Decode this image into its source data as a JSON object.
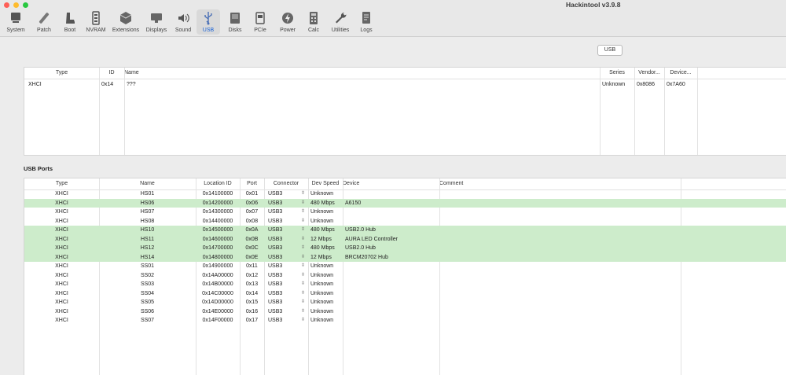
{
  "window": {
    "title": "Hackintool v3.9.8"
  },
  "toolbar": [
    {
      "label": "System",
      "icon": "system-icon"
    },
    {
      "label": "Patch",
      "icon": "patch-icon"
    },
    {
      "label": "Boot",
      "icon": "boot-icon"
    },
    {
      "label": "NVRAM",
      "icon": "nvram-icon"
    },
    {
      "label": "Extensions",
      "icon": "extensions-icon"
    },
    {
      "label": "Displays",
      "icon": "displays-icon"
    },
    {
      "label": "Sound",
      "icon": "sound-icon"
    },
    {
      "label": "USB",
      "icon": "usb-icon",
      "selected": true
    },
    {
      "label": "Disks",
      "icon": "disks-icon"
    },
    {
      "label": "PCIe",
      "icon": "pcie-icon"
    },
    {
      "label": "Power",
      "icon": "power-icon"
    },
    {
      "label": "Calc",
      "icon": "calc-icon"
    },
    {
      "label": "Utilities",
      "icon": "utilities-icon"
    },
    {
      "label": "Logs",
      "icon": "logs-icon"
    }
  ],
  "tab_label": "USB",
  "controllers": {
    "headers": [
      "Type",
      "ID",
      "Name",
      "Series",
      "Vendor...",
      "Device..."
    ],
    "rows": [
      {
        "type": "XHCI",
        "id": "0x14",
        "name": "???",
        "series": "Unknown",
        "vendor": "0x8086",
        "device": "0x7A60"
      }
    ]
  },
  "ports_label": "USB Ports",
  "ports": {
    "headers": [
      "Type",
      "Name",
      "Location ID",
      "Port",
      "Connector",
      "Dev Speed",
      "Device",
      "Comment"
    ],
    "rows": [
      {
        "type": "XHCI",
        "name": "HS01",
        "loc": "0x14100000",
        "port": "0x01",
        "conn": "USB3",
        "speed": "Unknown",
        "device": "",
        "hl": false
      },
      {
        "type": "XHCI",
        "name": "HS06",
        "loc": "0x14200000",
        "port": "0x06",
        "conn": "USB3",
        "speed": "480 Mbps",
        "device": "A6150",
        "hl": true
      },
      {
        "type": "XHCI",
        "name": "HS07",
        "loc": "0x14300000",
        "port": "0x07",
        "conn": "USB3",
        "speed": "Unknown",
        "device": "",
        "hl": false
      },
      {
        "type": "XHCI",
        "name": "HS08",
        "loc": "0x14400000",
        "port": "0x08",
        "conn": "USB3",
        "speed": "Unknown",
        "device": "",
        "hl": false
      },
      {
        "type": "XHCI",
        "name": "HS10",
        "loc": "0x14500000",
        "port": "0x0A",
        "conn": "USB3",
        "speed": "480 Mbps",
        "device": "USB2.0 Hub",
        "hl": true
      },
      {
        "type": "XHCI",
        "name": "HS11",
        "loc": "0x14600000",
        "port": "0x0B",
        "conn": "USB3",
        "speed": "12 Mbps",
        "device": "AURA LED Controller",
        "hl": true
      },
      {
        "type": "XHCI",
        "name": "HS12",
        "loc": "0x14700000",
        "port": "0x0C",
        "conn": "USB3",
        "speed": "480 Mbps",
        "device": "USB2.0 Hub",
        "hl": true
      },
      {
        "type": "XHCI",
        "name": "HS14",
        "loc": "0x14800000",
        "port": "0x0E",
        "conn": "USB3",
        "speed": "12 Mbps",
        "device": "BRCM20702 Hub",
        "hl": true
      },
      {
        "type": "XHCI",
        "name": "SS01",
        "loc": "0x14900000",
        "port": "0x11",
        "conn": "USB3",
        "speed": "Unknown",
        "device": "",
        "hl": false
      },
      {
        "type": "XHCI",
        "name": "SS02",
        "loc": "0x14A00000",
        "port": "0x12",
        "conn": "USB3",
        "speed": "Unknown",
        "device": "",
        "hl": false
      },
      {
        "type": "XHCI",
        "name": "SS03",
        "loc": "0x14B00000",
        "port": "0x13",
        "conn": "USB3",
        "speed": "Unknown",
        "device": "",
        "hl": false
      },
      {
        "type": "XHCI",
        "name": "SS04",
        "loc": "0x14C00000",
        "port": "0x14",
        "conn": "USB3",
        "speed": "Unknown",
        "device": "",
        "hl": false
      },
      {
        "type": "XHCI",
        "name": "SS05",
        "loc": "0x14D00000",
        "port": "0x15",
        "conn": "USB3",
        "speed": "Unknown",
        "device": "",
        "hl": false
      },
      {
        "type": "XHCI",
        "name": "SS06",
        "loc": "0x14E00000",
        "port": "0x16",
        "conn": "USB3",
        "speed": "Unknown",
        "device": "",
        "hl": false
      },
      {
        "type": "XHCI",
        "name": "SS07",
        "loc": "0x14F00000",
        "port": "0x17",
        "conn": "USB3",
        "speed": "Unknown",
        "device": "",
        "hl": false
      }
    ]
  },
  "colors": {
    "highlight": "#cdeccb",
    "accent": "#1a63d6",
    "close": "#fe5f57",
    "minimize": "#febc2e",
    "zoom": "#28c840"
  }
}
